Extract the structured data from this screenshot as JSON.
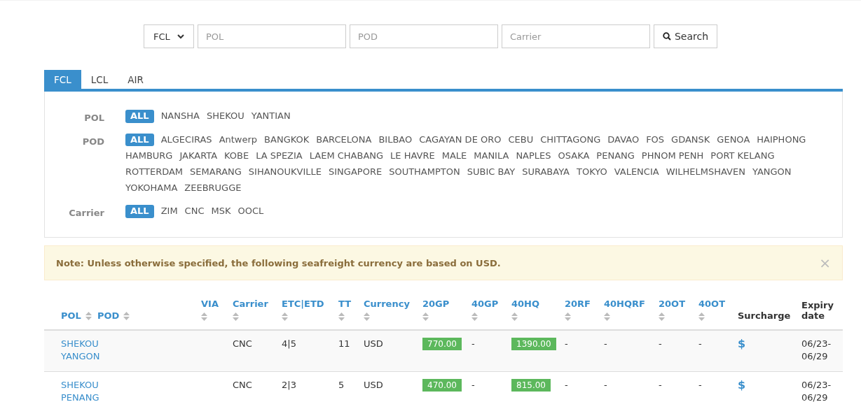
{
  "search": {
    "mode": "FCL",
    "fields": [
      {
        "placeholder": "POL"
      },
      {
        "placeholder": "POD"
      },
      {
        "placeholder": "Carrier"
      }
    ],
    "button": "Search"
  },
  "tabs": [
    {
      "label": "FCL",
      "selected": true
    },
    {
      "label": "LCL",
      "selected": false
    },
    {
      "label": "AIR",
      "selected": false
    }
  ],
  "filters": [
    {
      "label": "POL",
      "options": [
        {
          "text": "ALL",
          "selected": true
        },
        {
          "text": "NANSHA",
          "selected": false
        },
        {
          "text": "SHEKOU",
          "selected": false
        },
        {
          "text": "YANTIAN",
          "selected": false
        }
      ]
    },
    {
      "label": "POD",
      "options": [
        {
          "text": "ALL",
          "selected": true
        },
        {
          "text": "ALGECIRAS",
          "selected": false
        },
        {
          "text": "Antwerp",
          "selected": false
        },
        {
          "text": "BANGKOK",
          "selected": false
        },
        {
          "text": "BARCELONA",
          "selected": false
        },
        {
          "text": "BILBAO",
          "selected": false
        },
        {
          "text": "CAGAYAN DE ORO",
          "selected": false
        },
        {
          "text": "CEBU",
          "selected": false
        },
        {
          "text": "CHITTAGONG",
          "selected": false
        },
        {
          "text": "DAVAO",
          "selected": false
        },
        {
          "text": "FOS",
          "selected": false
        },
        {
          "text": "GDANSK",
          "selected": false
        },
        {
          "text": "GENOA",
          "selected": false
        },
        {
          "text": "HAIPHONG",
          "selected": false
        },
        {
          "text": "HAMBURG",
          "selected": false
        },
        {
          "text": "JAKARTA",
          "selected": false
        },
        {
          "text": "KOBE",
          "selected": false
        },
        {
          "text": "LA SPEZIA",
          "selected": false
        },
        {
          "text": "LAEM CHABANG",
          "selected": false
        },
        {
          "text": "LE HAVRE",
          "selected": false
        },
        {
          "text": "MALE",
          "selected": false
        },
        {
          "text": "MANILA",
          "selected": false
        },
        {
          "text": "NAPLES",
          "selected": false
        },
        {
          "text": "OSAKA",
          "selected": false
        },
        {
          "text": "PENANG",
          "selected": false
        },
        {
          "text": "PHNOM PENH",
          "selected": false
        },
        {
          "text": "PORT KELANG",
          "selected": false
        },
        {
          "text": "ROTTERDAM",
          "selected": false
        },
        {
          "text": "SEMARANG",
          "selected": false
        },
        {
          "text": "SIHANOUKVILLE",
          "selected": false
        },
        {
          "text": "SINGAPORE",
          "selected": false
        },
        {
          "text": "SOUTHAMPTON",
          "selected": false
        },
        {
          "text": "SUBIC BAY",
          "selected": false
        },
        {
          "text": "SURABAYA",
          "selected": false
        },
        {
          "text": "TOKYO",
          "selected": false
        },
        {
          "text": "VALENCIA",
          "selected": false
        },
        {
          "text": "WILHELMSHAVEN",
          "selected": false
        },
        {
          "text": "YANGON",
          "selected": false
        },
        {
          "text": "YOKOHAMA",
          "selected": false
        },
        {
          "text": "ZEEBRUGGE",
          "selected": false
        }
      ]
    },
    {
      "label": "Carrier",
      "options": [
        {
          "text": "ALL",
          "selected": true
        },
        {
          "text": "ZIM",
          "selected": false
        },
        {
          "text": "CNC",
          "selected": false
        },
        {
          "text": "MSK",
          "selected": false
        },
        {
          "text": "OOCL",
          "selected": false
        }
      ]
    }
  ],
  "note": {
    "text": "Note: Unless otherwise specified, the following seafreight currency are based on USD.",
    "close": "×"
  },
  "table": {
    "columns": [
      {
        "labels": [
          "POL",
          "POD"
        ],
        "sortable": true
      },
      {
        "labels": [
          "VIA"
        ],
        "sortable": true
      },
      {
        "labels": [
          "Carrier"
        ],
        "sortable": true
      },
      {
        "labels": [
          "ETC|ETD"
        ],
        "sortable": true
      },
      {
        "labels": [
          "TT"
        ],
        "sortable": true
      },
      {
        "labels": [
          "Currency"
        ],
        "sortable": true
      },
      {
        "labels": [
          "20GP"
        ],
        "sortable": true
      },
      {
        "labels": [
          "40GP"
        ],
        "sortable": true
      },
      {
        "labels": [
          "40HQ"
        ],
        "sortable": true
      },
      {
        "labels": [
          "20RF"
        ],
        "sortable": true
      },
      {
        "labels": [
          "40HQRF"
        ],
        "sortable": true
      },
      {
        "labels": [
          "20OT"
        ],
        "sortable": true
      },
      {
        "labels": [
          "40OT"
        ],
        "sortable": true
      },
      {
        "labels": [
          "Surcharge"
        ],
        "sortable": false
      },
      {
        "labels": [
          "Expiry date"
        ],
        "sortable": false
      }
    ],
    "rows": [
      {
        "pol": "SHEKOU",
        "pod": "YANGON",
        "carrier": "CNC",
        "etc_etd": "4|5",
        "tt": "11",
        "currency": "USD",
        "prices": [
          {
            "text": "770.00",
            "kind": "badge"
          },
          {
            "text": "-",
            "kind": "plain"
          },
          {
            "text": "1390.00",
            "kind": "badge"
          },
          {
            "text": "-",
            "kind": "plain"
          },
          {
            "text": "-",
            "kind": "plain"
          },
          {
            "text": "-",
            "kind": "plain"
          },
          {
            "text": "-",
            "kind": "plain"
          }
        ],
        "surcharge": "$",
        "expiry": "06/23-06/29"
      },
      {
        "pol": "SHEKOU",
        "pod": "PENANG",
        "carrier": "CNC",
        "etc_etd": "2|3",
        "tt": "5",
        "currency": "USD",
        "prices": [
          {
            "text": "470.00",
            "kind": "badge"
          },
          {
            "text": "-",
            "kind": "plain"
          },
          {
            "text": "815.00",
            "kind": "badge"
          },
          {
            "text": "-",
            "kind": "plain"
          },
          {
            "text": "-",
            "kind": "plain"
          },
          {
            "text": "-",
            "kind": "plain"
          },
          {
            "text": "-",
            "kind": "plain"
          }
        ],
        "surcharge": "$",
        "expiry": "06/23-06/29"
      }
    ]
  }
}
